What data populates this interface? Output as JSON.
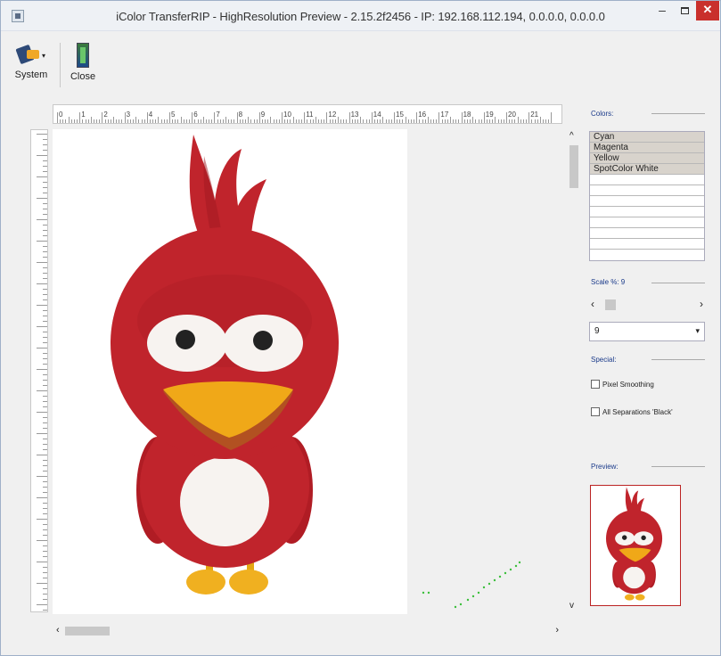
{
  "window": {
    "title": "iColor TransferRIP - HighResolution Preview - 2.15.2f2456 - IP: 192.168.112.194, 0.0.0.0, 0.0.0.0",
    "min_glyph": "–",
    "close_glyph": "✕"
  },
  "toolbar": {
    "system_label": "System",
    "close_label": "Close"
  },
  "ruler": {
    "labels": [
      "0",
      "1",
      "2",
      "3",
      "4",
      "5",
      "6",
      "7",
      "8",
      "9",
      "10",
      "11",
      "12",
      "13",
      "14",
      "15",
      "16",
      "17",
      "18",
      "19",
      "20",
      "21"
    ]
  },
  "scrollbars": {
    "up": "^",
    "down": "v",
    "left": "‹",
    "right": "›"
  },
  "panel": {
    "colors_label": "Colors:",
    "colors": [
      "Cyan",
      "Magenta",
      "Yellow",
      "SpotColor White",
      "",
      "",
      "",
      "",
      "",
      "",
      ""
    ],
    "scale_label": "Scale %: 9",
    "scale_value": "9",
    "special_label": "Special:",
    "pixel_smoothing_label": "Pixel Smoothing",
    "pixel_smoothing_checked": false,
    "all_separations_label": "All Separations 'Black'",
    "all_separations_checked": false,
    "preview_label": "Preview:"
  },
  "colors_theme": {
    "bird_red": "#c0242c",
    "bird_dark": "#a01820",
    "beak": "#f0a818",
    "close_btn": "#c9302c",
    "panel_label": "#1a3a8a"
  }
}
